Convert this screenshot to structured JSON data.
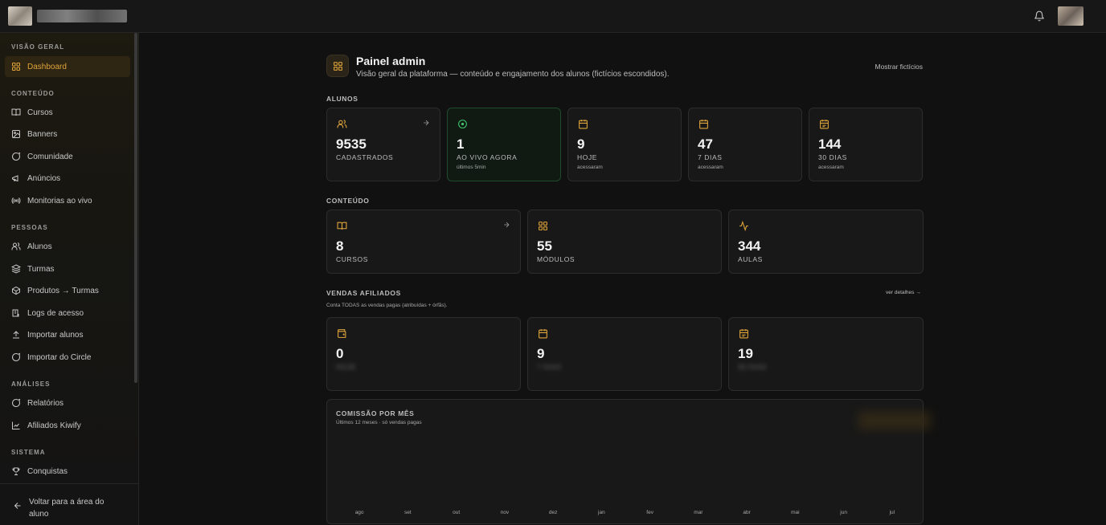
{
  "topbar": {
    "brand_icon": "logo",
    "notification_icon": "bell-icon"
  },
  "sidebar": {
    "sections": [
      {
        "label": "VISÃO GERAL",
        "items": [
          {
            "label": "Dashboard",
            "icon": "grid-icon",
            "active": true
          }
        ]
      },
      {
        "label": "CONTEÚDO",
        "items": [
          {
            "label": "Cursos",
            "icon": "book-icon"
          },
          {
            "label": "Banners",
            "icon": "image-icon"
          },
          {
            "label": "Comunidade",
            "icon": "chat-icon"
          },
          {
            "label": "Anúncios",
            "icon": "megaphone-icon"
          },
          {
            "label": "Monitorias ao vivo",
            "icon": "broadcast-icon"
          }
        ]
      },
      {
        "label": "PESSOAS",
        "items": [
          {
            "label": "Alunos",
            "icon": "users-icon"
          },
          {
            "label": "Turmas",
            "icon": "layers-icon"
          },
          {
            "label": "Produtos → Turmas",
            "icon": "package-icon"
          },
          {
            "label": "Logs de acesso",
            "icon": "log-icon"
          },
          {
            "label": "Importar alunos",
            "icon": "upload-icon"
          },
          {
            "label": "Importar do Circle",
            "icon": "circle-icon"
          }
        ]
      },
      {
        "label": "ANÁLISES",
        "items": [
          {
            "label": "Relatórios",
            "icon": "chat-icon"
          },
          {
            "label": "Afiliados Kiwify",
            "icon": "chart-icon"
          }
        ]
      },
      {
        "label": "SISTEMA",
        "items": [
          {
            "label": "Conquistas",
            "icon": "trophy-icon"
          }
        ]
      }
    ],
    "back_label": "Voltar para a área do aluno"
  },
  "header": {
    "title": "Painel admin",
    "subtitle": "Visão geral da plataforma — conteúdo e engajamento dos alunos (fictícios escondidos).",
    "show_fictitious": "Mostrar fictícios"
  },
  "alunos": {
    "label": "ALUNOS",
    "cards": [
      {
        "value": "9535",
        "label": "CADASTRADOS",
        "sub": "",
        "icon": "users-icon"
      },
      {
        "value": "1",
        "label": "AO VIVO AGORA",
        "sub": "últimos 5min",
        "icon": "live-icon"
      },
      {
        "value": "9",
        "label": "HOJE",
        "sub": "acessaram",
        "icon": "calendar-icon"
      },
      {
        "value": "47",
        "label": "7 DIAS",
        "sub": "acessaram",
        "icon": "calendar-icon"
      },
      {
        "value": "144",
        "label": "30 DIAS",
        "sub": "acessaram",
        "icon": "calendar-icon"
      }
    ]
  },
  "conteudo": {
    "label": "CONTEÚDO",
    "cards": [
      {
        "value": "8",
        "label": "CURSOS",
        "icon": "book-icon"
      },
      {
        "value": "55",
        "label": "MÓDULOS",
        "icon": "grid-icon"
      },
      {
        "value": "344",
        "label": "AULAS",
        "icon": "activity-icon"
      }
    ]
  },
  "vendas": {
    "label": "VENDAS AFILIADOS",
    "note": "Conta TODAS as vendas pagas (atribuídas + órfãs).",
    "details": "ver detalhes →",
    "cards": [
      {
        "value": "0",
        "label": "HOJE",
        "icon": "wallet-icon"
      },
      {
        "value": "9",
        "label": "7 DIAS",
        "icon": "calendar-icon"
      },
      {
        "value": "19",
        "label": "30 DIAS",
        "icon": "calendar-icon"
      }
    ]
  },
  "chart_data": {
    "type": "bar",
    "title": "COMISSÃO POR MÊS",
    "subtitle": "Últimos 12 meses · só vendas pagas",
    "categories": [
      "ago",
      "set",
      "out",
      "nov",
      "dez",
      "jan",
      "fev",
      "mar",
      "abr",
      "mai",
      "jun",
      "jul"
    ],
    "series": [
      {
        "values": [
          0,
          0,
          0,
          0,
          0,
          0,
          0,
          0,
          0,
          0,
          0,
          0
        ]
      }
    ],
    "xlabel": "",
    "ylabel": "",
    "grid": false,
    "accent": "#e0a53a"
  }
}
